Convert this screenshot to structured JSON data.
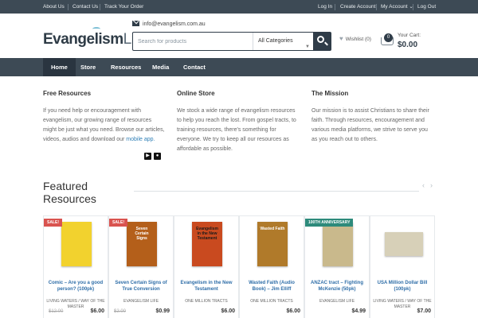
{
  "topbar": {
    "about": "About Us",
    "contact": "Contact Us",
    "track": "Track Your Order",
    "login": "Log In",
    "create": "Create Account",
    "account": "My Account ⌄",
    "logout": "Log Out"
  },
  "header": {
    "logo_bold": "Evangelism",
    "logo_light": "Life",
    "email": "info@evangelism.com.au",
    "search_placeholder": "Search for products",
    "category": "All Categories",
    "wishlist": "Wishlist (0)",
    "cart_count": "0",
    "cart_label": "Your Cart:",
    "cart_total": "$0.00"
  },
  "nav": {
    "items": [
      "Home",
      "Store",
      "Resources",
      "Media",
      "Contact"
    ],
    "active": "Home"
  },
  "menu": {
    "free": {
      "title": "Free Resources",
      "text": "If you need help or encouragement with evangelism, our growing range of resources might be just what you need. Browse our articles, videos, audios and download our ",
      "link": "mobile app."
    },
    "store": {
      "title": "Online Store",
      "text": "We stock a wide range of evangelism resources to help you reach the lost. From gospel tracts, to training resources, there's something for everyone. We try to keep all our resources as affordable as possible."
    },
    "mission": {
      "title": "The Mission",
      "text": "Our mission is to assist Christians to share their faith. Through resources, encouragement and various media platforms, we strive to serve you as you reach out to others."
    }
  },
  "featured": {
    "title_line1": "Featured",
    "title_line2": "Resources",
    "prev": "‹",
    "next": "›"
  },
  "products": [
    {
      "badge": "SALE!",
      "badge_type": "sale",
      "title": "Comic – Are you a good person? (100pk)",
      "author": "LIVING WATERS / WAY OF THE MASTER",
      "old_price": "$12.00",
      "price": "$6.00",
      "cover_bg": "#f2d22e",
      "cover_text": "",
      "cover_color": "#c0392b"
    },
    {
      "badge": "SALE!",
      "badge_type": "sale",
      "title": "Seven Certain Signs of True Conversion",
      "author": "EVANGELISM LIFE",
      "old_price": "$2.00",
      "price": "$0.99",
      "cover_bg": "#b45f1a",
      "cover_text": "Seven Certain Signs",
      "cover_color": "#ffffff"
    },
    {
      "badge": "",
      "badge_type": "",
      "title": "Evangelism in the New Testament",
      "author": "ONE MILLION TRACTS",
      "old_price": "",
      "price": "$6.00",
      "cover_bg": "#c94a1f",
      "cover_text": "Evangelism in the New Testament",
      "cover_color": "#1a1a1a"
    },
    {
      "badge": "",
      "badge_type": "",
      "title": "Wasted Faith (Audio Book) – Jim Elliff",
      "author": "ONE MILLION TRACTS",
      "old_price": "",
      "price": "$6.00",
      "cover_bg": "#b07a2a",
      "cover_text": "Wasted Faith",
      "cover_color": "#ffffff"
    },
    {
      "badge": "100TH ANNIVERSARY",
      "badge_type": "anniv",
      "title": "ANZAC tract – Fighting McKenzie (50pk)",
      "author": "EVANGELISM LIFE",
      "old_price": "",
      "price": "$4.99",
      "cover_bg": "#c9b98c",
      "cover_text": "",
      "cover_color": "#333333"
    },
    {
      "badge": "",
      "badge_type": "",
      "title": "USA Million Dollar Bill (100pk)",
      "author": "LIVING WATERS / WAY OF THE MASTER",
      "old_price": "",
      "price": "$7.00",
      "cover_bg": "#d7d0b8",
      "cover_text": "",
      "cover_color": "#5a3a28"
    }
  ]
}
